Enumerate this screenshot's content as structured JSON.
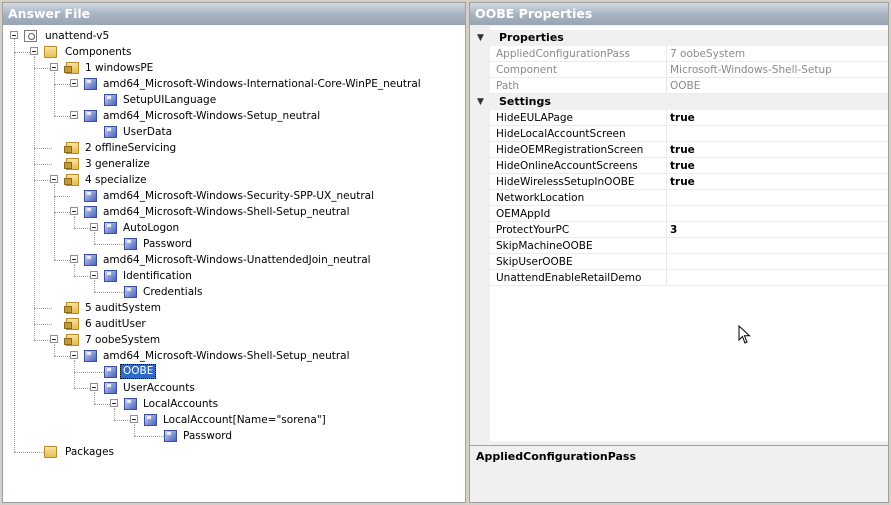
{
  "left_panel": {
    "title": "Answer File",
    "tree": [
      {
        "label": "unattend-v5",
        "icon": "answer-file-icon"
      },
      {
        "label": "Components",
        "icon": "folder-icon"
      },
      {
        "label": "1 windowsPE",
        "icon": "config-pass-icon"
      },
      {
        "label": "amd64_Microsoft-Windows-International-Core-WinPE_neutral",
        "icon": "component-icon"
      },
      {
        "label": "SetupUILanguage",
        "icon": "component-icon"
      },
      {
        "label": "amd64_Microsoft-Windows-Setup_neutral",
        "icon": "component-icon"
      },
      {
        "label": "UserData",
        "icon": "component-icon"
      },
      {
        "label": "2 offlineServicing",
        "icon": "config-pass-icon"
      },
      {
        "label": "3 generalize",
        "icon": "config-pass-icon"
      },
      {
        "label": "4 specialize",
        "icon": "config-pass-icon"
      },
      {
        "label": "amd64_Microsoft-Windows-Security-SPP-UX_neutral",
        "icon": "component-icon"
      },
      {
        "label": "amd64_Microsoft-Windows-Shell-Setup_neutral",
        "icon": "component-icon"
      },
      {
        "label": "AutoLogon",
        "icon": "component-icon"
      },
      {
        "label": "Password",
        "icon": "component-icon"
      },
      {
        "label": "amd64_Microsoft-Windows-UnattendedJoin_neutral",
        "icon": "component-icon"
      },
      {
        "label": "Identification",
        "icon": "component-icon"
      },
      {
        "label": "Credentials",
        "icon": "component-icon"
      },
      {
        "label": "5 auditSystem",
        "icon": "config-pass-icon"
      },
      {
        "label": "6 auditUser",
        "icon": "config-pass-icon"
      },
      {
        "label": "7 oobeSystem",
        "icon": "config-pass-icon"
      },
      {
        "label": "amd64_Microsoft-Windows-Shell-Setup_neutral",
        "icon": "component-icon"
      },
      {
        "label": "OOBE",
        "icon": "component-icon"
      },
      {
        "label": "UserAccounts",
        "icon": "component-icon"
      },
      {
        "label": "LocalAccounts",
        "icon": "component-icon"
      },
      {
        "label": "LocalAccount[Name=\"sorena\"]",
        "icon": "component-icon"
      },
      {
        "label": "Password",
        "icon": "component-icon"
      },
      {
        "label": "Packages",
        "icon": "folder-icon"
      }
    ],
    "selected_label": "OOBE"
  },
  "right_panel": {
    "title": "OOBE Properties",
    "categories": [
      {
        "label": "Properties",
        "rows": [
          {
            "name": "AppliedConfigurationPass",
            "value": "7 oobeSystem",
            "readonly": true
          },
          {
            "name": "Component",
            "value": "Microsoft-Windows-Shell-Setup",
            "readonly": true
          },
          {
            "name": "Path",
            "value": "OOBE",
            "readonly": true
          }
        ]
      },
      {
        "label": "Settings",
        "rows": [
          {
            "name": "HideEULAPage",
            "value": "true"
          },
          {
            "name": "HideLocalAccountScreen",
            "value": ""
          },
          {
            "name": "HideOEMRegistrationScreen",
            "value": "true"
          },
          {
            "name": "HideOnlineAccountScreens",
            "value": "true"
          },
          {
            "name": "HideWirelessSetupInOOBE",
            "value": "true"
          },
          {
            "name": "NetworkLocation",
            "value": ""
          },
          {
            "name": "OEMAppId",
            "value": ""
          },
          {
            "name": "ProtectYourPC",
            "value": "3"
          },
          {
            "name": "SkipMachineOOBE",
            "value": ""
          },
          {
            "name": "SkipUserOOBE",
            "value": ""
          },
          {
            "name": "UnattendEnableRetailDemo",
            "value": ""
          }
        ]
      }
    ],
    "description_title": "AppliedConfigurationPass"
  },
  "colors": {
    "header_gradient_top": "#d2d9e2",
    "header_gradient_bottom": "#98a4b3",
    "selection": "#3169c6"
  }
}
